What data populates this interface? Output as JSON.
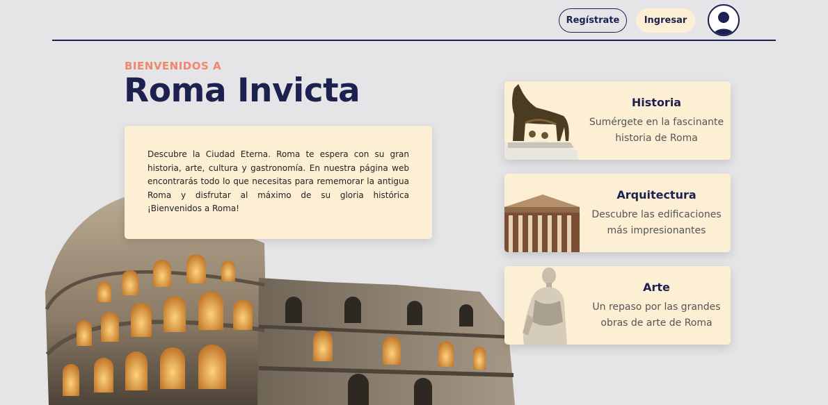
{
  "header": {
    "register_label": "Regístrate",
    "login_label": "Ingresar",
    "avatar_icon": "user-icon"
  },
  "hero": {
    "eyebrow": "BIENVENIDOS A",
    "title": "Roma Invicta",
    "intro": "Descubre la Ciudad Eterna. Roma te espera con su gran historia, arte, cultura y gastronomía. En nuestra página web encontrarás todo lo que necesitas para rememorar la antigua Roma y disfrutar al máximo de su gloria histórica ¡Bienvenidos a Roma!",
    "image": "colosseum-image"
  },
  "cards": [
    {
      "title": "Historia",
      "description": "Sumérgete en la fascinante historia de Roma",
      "image": "capitoline-wolf-image"
    },
    {
      "title": "Arquitectura",
      "description": "Descubre las edificaciones más impresionantes",
      "image": "pantheon-image"
    },
    {
      "title": "Arte",
      "description": "Un repaso por las grandes obras de arte de Roma",
      "image": "caesar-statue-image"
    }
  ],
  "colors": {
    "navy": "#1c2150",
    "accent": "#f0866c",
    "cream": "#fdefd3",
    "background": "#e5e5e7"
  }
}
